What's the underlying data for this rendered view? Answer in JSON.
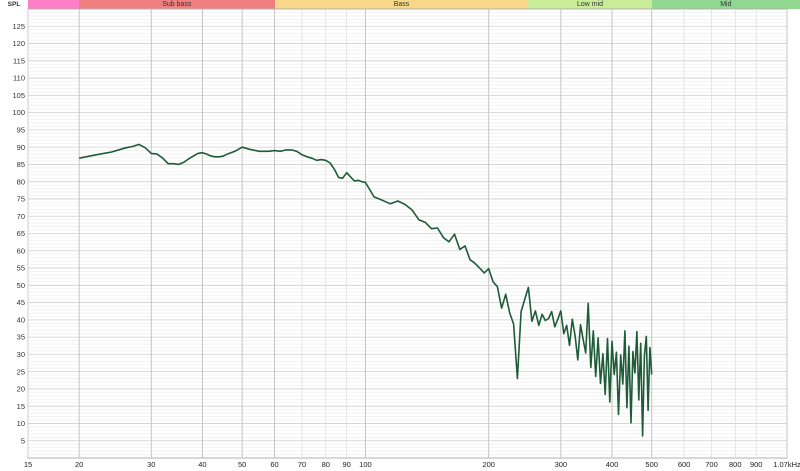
{
  "axis_title": "SPL",
  "bands": [
    {
      "label": "",
      "color": "#ff80c8"
    },
    {
      "label": "Sub bass",
      "color": "#f08080"
    },
    {
      "label": "Bass",
      "color": "#f8d888"
    },
    {
      "label": "Low mid",
      "color": "#c8ec98"
    },
    {
      "label": "Mid",
      "color": "#90d890"
    }
  ],
  "chart_data": {
    "type": "line",
    "title": "",
    "xlabel": "",
    "ylabel": "SPL",
    "xscale": "log",
    "xlim": [
      15,
      1070
    ],
    "ylim": [
      0,
      130
    ],
    "grid": true,
    "x_ticks": [
      {
        "value": 15,
        "label": "15"
      },
      {
        "value": 20,
        "label": "20"
      },
      {
        "value": 30,
        "label": "30"
      },
      {
        "value": 40,
        "label": "40"
      },
      {
        "value": 50,
        "label": "50"
      },
      {
        "value": 60,
        "label": "60"
      },
      {
        "value": 70,
        "label": "70"
      },
      {
        "value": 80,
        "label": "80"
      },
      {
        "value": 90,
        "label": "90"
      },
      {
        "value": 100,
        "label": "100"
      },
      {
        "value": 200,
        "label": "200"
      },
      {
        "value": 300,
        "label": "300"
      },
      {
        "value": 400,
        "label": "400"
      },
      {
        "value": 500,
        "label": "500"
      },
      {
        "value": 600,
        "label": "600"
      },
      {
        "value": 700,
        "label": "700"
      },
      {
        "value": 800,
        "label": "800"
      },
      {
        "value": 900,
        "label": "900"
      },
      {
        "value": 1070,
        "label": "1.07kHz"
      }
    ],
    "y_ticks": [
      "5",
      "10",
      "15",
      "20",
      "25",
      "30",
      "35",
      "40",
      "45",
      "50",
      "55",
      "60",
      "65",
      "70",
      "75",
      "80",
      "85",
      "90",
      "95",
      "100",
      "105",
      "110",
      "115",
      "120",
      "125"
    ],
    "band_ranges_hz": [
      [
        15,
        20
      ],
      [
        20,
        60
      ],
      [
        60,
        250
      ],
      [
        250,
        500
      ],
      [
        500,
        1070
      ]
    ],
    "series": [
      {
        "color": "#1e5c38",
        "x": [
          20,
          22,
          24,
          26,
          27,
          28,
          29,
          30,
          31,
          32,
          33,
          34,
          35,
          36,
          37,
          38,
          39,
          40,
          41,
          42,
          43,
          44,
          45,
          46,
          48,
          50,
          52,
          55,
          58,
          60,
          62,
          64,
          66,
          68,
          70,
          72,
          74,
          76,
          78,
          80,
          82,
          84,
          86,
          88,
          90,
          92,
          94,
          96,
          98,
          100,
          105,
          110,
          115,
          120,
          125,
          130,
          135,
          140,
          145,
          150,
          155,
          160,
          165,
          170,
          175,
          180,
          185,
          190,
          195,
          200,
          205,
          210,
          215,
          220,
          225,
          230,
          235,
          240,
          245,
          250,
          255,
          260,
          265,
          270,
          275,
          280,
          285,
          290,
          295,
          300,
          305,
          310,
          315,
          320,
          325,
          330,
          335,
          340,
          345,
          350,
          355,
          360,
          365,
          370,
          375,
          380,
          385,
          390,
          395,
          400,
          405,
          410,
          415,
          420,
          425,
          430,
          435,
          440,
          445,
          450,
          455,
          460,
          465,
          470,
          475,
          480,
          485,
          490,
          495,
          500
        ],
        "y": [
          86.8,
          87.8,
          88.6,
          89.8,
          90.2,
          90.8,
          89.8,
          88.2,
          88.0,
          86.8,
          85.2,
          85.2,
          85.0,
          85.6,
          86.6,
          87.4,
          88.2,
          88.4,
          88.0,
          87.4,
          87.2,
          87.2,
          87.4,
          88.0,
          88.8,
          90.0,
          89.4,
          88.8,
          88.8,
          89.0,
          88.8,
          89.2,
          89.2,
          88.8,
          87.8,
          87.2,
          86.8,
          86.2,
          86.4,
          86.2,
          85.4,
          83.6,
          81.2,
          81.0,
          82.6,
          81.4,
          80.2,
          80.4,
          80.0,
          79.8,
          75.6,
          74.6,
          73.6,
          74.4,
          73.4,
          71.8,
          69.0,
          68.2,
          66.4,
          66.6,
          63.8,
          62.6,
          64.8,
          60.4,
          61.4,
          57.4,
          56.4,
          55.0,
          53.6,
          54.8,
          51.0,
          49.6,
          43.4,
          47.4,
          42.0,
          38.8,
          23.0,
          42.4,
          46.0,
          49.4,
          39.6,
          42.6,
          38.4,
          41.6,
          39.8,
          40.4,
          42.4,
          38.0,
          40.2,
          42.6,
          36.0,
          38.4,
          32.6,
          40.2,
          35.4,
          28.4,
          38.6,
          34.4,
          30.4,
          44.8,
          26.2,
          36.8,
          23.6,
          34.8,
          21.6,
          30.2,
          18.4,
          34.6,
          16.2,
          33.8,
          24.2,
          30.6,
          12.6,
          29.8,
          21.4,
          36.8,
          14.6,
          32.4,
          10.2,
          30.8,
          24.6,
          36.6,
          16.8,
          33.2,
          6.4,
          29.6,
          35.2,
          13.8,
          32.0,
          24.2
        ]
      }
    ]
  }
}
